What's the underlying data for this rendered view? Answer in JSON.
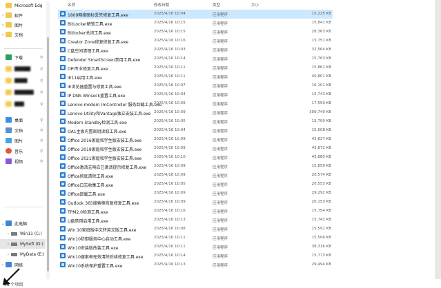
{
  "columns": {
    "name": "名称",
    "date": "修改日期",
    "type": "类型",
    "size": "大小"
  },
  "sidebar": {
    "top_folders": [
      "Microsoft Edg",
      "软件",
      "图片",
      "文档"
    ],
    "quick_access": [
      "下载",
      "桌面",
      "文档",
      "图片",
      "音乐",
      "视频"
    ],
    "this_pc": "此电脑",
    "drives": [
      "Win11 (C:)",
      "MySoft (D:)",
      "MyData (E:)"
    ],
    "network": "网络"
  },
  "files": [
    {
      "name": "1809网络图标丢失修复工具.exe",
      "date": "2025/4/16 10:04",
      "type": "应用程序",
      "size": "15,225 KB"
    },
    {
      "name": "BitLocker解锁工具.exe",
      "date": "2025/4/16 10:15",
      "type": "应用程序",
      "size": "15,841 KB"
    },
    {
      "name": "Bitlocker关闭工具.exe",
      "date": "2025/4/16 10:15",
      "type": "应用程序",
      "size": "28,363 KB"
    },
    {
      "name": "Creator Zone修复修复工具.exe",
      "date": "2025/4/16 10:16",
      "type": "应用程序",
      "size": "15,751 KB"
    },
    {
      "name": "C盘空间清理工具.exe",
      "date": "2025/4/16 10:03",
      "type": "应用程序",
      "size": "32,564 KB"
    },
    {
      "name": "Defender SmartScreen禁用工具.exe",
      "date": "2025/4/16 10:14",
      "type": "应用程序",
      "size": "15,763 KB"
    },
    {
      "name": "DPI专业修复工具.exe",
      "date": "2025/4/16 10:11",
      "type": "应用程序",
      "size": "15,861 KB"
    },
    {
      "name": "IE11启用工具.exe",
      "date": "2025/4/16 10:11",
      "type": "应用程序",
      "size": "40,801 KB"
    },
    {
      "name": "IE浏览器重置与修复工具.exe",
      "date": "2025/4/16 10:07",
      "type": "应用程序",
      "size": "16,101 KB"
    },
    {
      "name": "IP DNS Winsock重置工具.exe",
      "date": "2025/4/16 10:04",
      "type": "应用程序",
      "size": "15,743 KB"
    },
    {
      "name": "Lenovo modern ImController 服务卸载工具.exe",
      "date": "2025/4/16 10:09",
      "type": "应用程序",
      "size": "17,550 KB"
    },
    {
      "name": "Lenovo Utility和Vantage独立安装工具.exe",
      "date": "2025/4/16 10:09",
      "type": "应用程序",
      "size": "309,749 KB"
    },
    {
      "name": "Modern Standby检测工具.exe",
      "date": "2025/4/16 10:05",
      "type": "应用程序",
      "size": "15,700 KB"
    },
    {
      "name": "OA1主板内置密钥读取工具.exe",
      "date": "2025/4/16 10:04",
      "type": "应用程序",
      "size": "15,608 KB"
    },
    {
      "name": "Office 2016家庭和学生版安装工具.exe",
      "date": "2025/4/16 10:09",
      "type": "应用程序",
      "size": "43,827 KB"
    },
    {
      "name": "Office 2019家庭和学生版安装工具.exe",
      "date": "2025/4/16 10:09",
      "type": "应用程序",
      "size": "43,872 KB"
    },
    {
      "name": "Office 2021家庭和学生版安装工具.exe",
      "date": "2025/4/16 10:10",
      "type": "应用程序",
      "size": "43,880 KB"
    },
    {
      "name": "Office激活无响应已激活提示修复工具.exe",
      "date": "2025/4/16 10:09",
      "type": "应用程序",
      "size": "15,859 KB"
    },
    {
      "name": "Office彻底清除工具.exe",
      "date": "2025/4/16 10:09",
      "type": "应用程序",
      "size": "20,574 KB"
    },
    {
      "name": "Office日志收集工具.exe",
      "date": "2025/4/16 10:05",
      "type": "应用程序",
      "size": "20,553 KB"
    },
    {
      "name": "Office卸载工具.exe",
      "date": "2025/4/16 10:09",
      "type": "应用程序",
      "size": "29,292 KB"
    },
    {
      "name": "Outlook 365搜索框恢复修复工具.exe",
      "date": "2025/4/16 10:09",
      "type": "应用程序",
      "size": "20,153 KB"
    },
    {
      "name": "TPM2.0检测工具.exe",
      "date": "2025/4/16 10:16",
      "type": "应用程序",
      "size": "15,754 KB"
    },
    {
      "name": "U盘禁用启用工具.exe",
      "date": "2025/4/16 10:13",
      "type": "应用程序",
      "size": "15,742 KB"
    },
    {
      "name": "Win 10家庭版中文转英文版工具.exe",
      "date": "2025/4/16 10:08",
      "type": "应用程序",
      "size": "15,591 KB"
    },
    {
      "name": "Win10防御服务中心启动工具.exe",
      "date": "2025/4/16 10:11",
      "type": "应用程序",
      "size": "15,506 KB"
    },
    {
      "name": "Win10安装版改装工具.exe",
      "date": "2025/4/16 10:11",
      "type": "应用程序",
      "size": "38,316 KB"
    },
    {
      "name": "Win10搜索框无效清除后续修复工具.exe",
      "date": "2025/4/16 10:14",
      "type": "应用程序",
      "size": "15,773 KB"
    },
    {
      "name": "Win10系统保护重置工具.exe",
      "date": "2025/4/16 10:13",
      "type": "应用程序",
      "size": "29,494 KB"
    }
  ],
  "status": {
    "count_text": "98 个项目"
  },
  "colors": {
    "accent": "#2b7cd3",
    "folder": "#f2c94c",
    "selected_nav": "#e5e5e5",
    "selected_row": "#cce8ff"
  }
}
